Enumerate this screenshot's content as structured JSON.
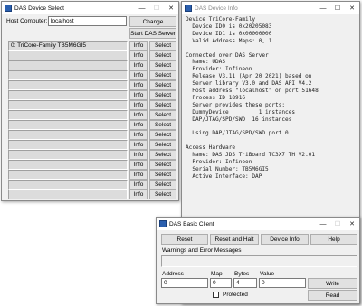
{
  "device_select": {
    "title": "DAS Device Select",
    "host_label": "Host Computer:",
    "host_value": "localhost",
    "change_label": "Change",
    "start_server_label": "Start DAS Server",
    "rows": [
      {
        "text": "0: TriCore-Family TB5M6GI5",
        "info": "Info",
        "select": "Select"
      },
      {
        "text": "",
        "info": "Info",
        "select": "Select"
      },
      {
        "text": "",
        "info": "Info",
        "select": "Select"
      },
      {
        "text": "",
        "info": "Info",
        "select": "Select"
      },
      {
        "text": "",
        "info": "Info",
        "select": "Select"
      },
      {
        "text": "",
        "info": "Info",
        "select": "Select"
      },
      {
        "text": "",
        "info": "Info",
        "select": "Select"
      },
      {
        "text": "",
        "info": "Info",
        "select": "Select"
      },
      {
        "text": "",
        "info": "Info",
        "select": "Select"
      },
      {
        "text": "",
        "info": "Info",
        "select": "Select"
      },
      {
        "text": "",
        "info": "Info",
        "select": "Select"
      },
      {
        "text": "",
        "info": "Info",
        "select": "Select"
      },
      {
        "text": "",
        "info": "Info",
        "select": "Select"
      },
      {
        "text": "",
        "info": "Info",
        "select": "Select"
      },
      {
        "text": "",
        "info": "Info",
        "select": "Select"
      },
      {
        "text": "",
        "info": "Info",
        "select": "Select"
      }
    ]
  },
  "device_info": {
    "title": "DAS Device Info",
    "lines": [
      "Device TriCore-Family",
      "  Device ID0 is 0x20205083",
      "  Device ID1 is 0x00000000",
      "  Valid Address Maps: 0, 1",
      "",
      "Connected over DAS Server",
      "  Name: UDAS",
      "  Provider: Infineon",
      "  Release V3.11 (Apr 20 2021) based on",
      "  Server library V3.0 and DAS API V4.2",
      "  Host address \"localhost\" on port 51648",
      "  Process ID 18916",
      "  Server provides these ports:",
      "  DummyDevice         1 instances",
      "  DAP/JTAG/SPD/SWD  16 instances",
      "",
      "  Using DAP/JTAG/SPD/SWD port 0",
      "",
      "Access Hardware",
      "  Name: DAS JDS TriBoard TC3X7 TH V2.01",
      "  Provider: Infineon",
      "  Serial Number: TB5M6GI5",
      "  Active Interface: DAP"
    ]
  },
  "basic_client": {
    "title": "DAS Basic Client",
    "reset_label": "Reset",
    "reset_halt_label": "Reset and Halt",
    "device_info_label": "Device Info",
    "help_label": "Help",
    "warnings_label": "Warnings and Error Messages",
    "address_label": "Address",
    "map_label": "Map",
    "bytes_label": "Bytes",
    "value_label": "Value",
    "address_value": "0",
    "map_value": "0",
    "bytes_value": "4",
    "value_value": "0",
    "write_label": "Write",
    "read_label": "Read",
    "protected_label": "Protected"
  },
  "window_controls": {
    "minimize": "—",
    "maximize": "☐",
    "close": "✕"
  }
}
